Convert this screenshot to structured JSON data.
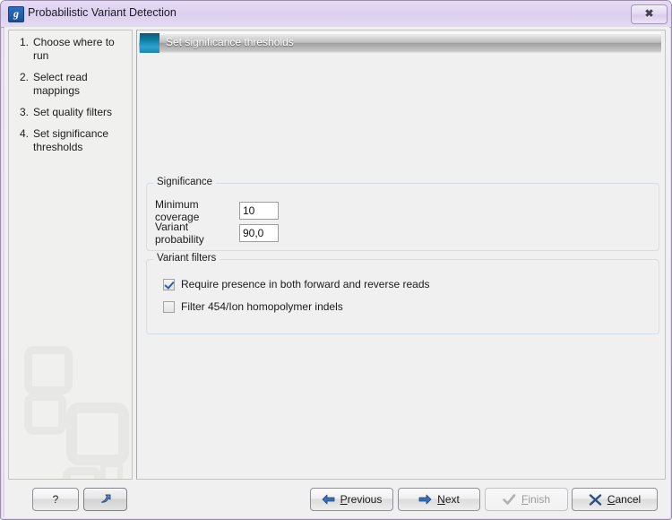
{
  "window": {
    "title": "Probabilistic Variant Detection",
    "app_icon": "application-icon",
    "app_icon_glyph": "g",
    "close_label": "✖",
    "titlebar_color": "#ddd0ef",
    "frame_color": "#9c8fae"
  },
  "sidebar": {
    "steps": [
      {
        "num": "1.",
        "label": "Choose where to run"
      },
      {
        "num": "2.",
        "label": "Select read mappings"
      },
      {
        "num": "3.",
        "label": "Set quality filters"
      },
      {
        "num": "4.",
        "label": "Set significance thresholds"
      }
    ]
  },
  "main": {
    "banner": {
      "title": "Set significance thresholds",
      "icon_color": "#1d86ae"
    },
    "groups": [
      {
        "title": "Significance",
        "fields": [
          {
            "label": "Minimum coverage",
            "value": "10"
          },
          {
            "label": "Variant probability",
            "value": "90,0"
          }
        ]
      },
      {
        "title": "Variant filters",
        "checkboxes": [
          {
            "label": "Require presence in both forward and reverse reads",
            "checked": true
          },
          {
            "label": "Filter 454/Ion homopolymer indels",
            "checked": false
          }
        ]
      }
    ]
  },
  "buttons": {
    "help": {
      "label": "?"
    },
    "reset": {
      "label": ""
    },
    "previous": {
      "label_pre": "",
      "mnemonic": "P",
      "label_post": "revious",
      "enabled": true
    },
    "next": {
      "label_pre": "",
      "mnemonic": "N",
      "label_post": "ext",
      "enabled": true
    },
    "finish": {
      "label_pre": "",
      "mnemonic": "F",
      "label_post": "inish",
      "enabled": false
    },
    "cancel": {
      "label_pre": "",
      "mnemonic": "C",
      "label_post": "ancel",
      "enabled": true
    }
  }
}
